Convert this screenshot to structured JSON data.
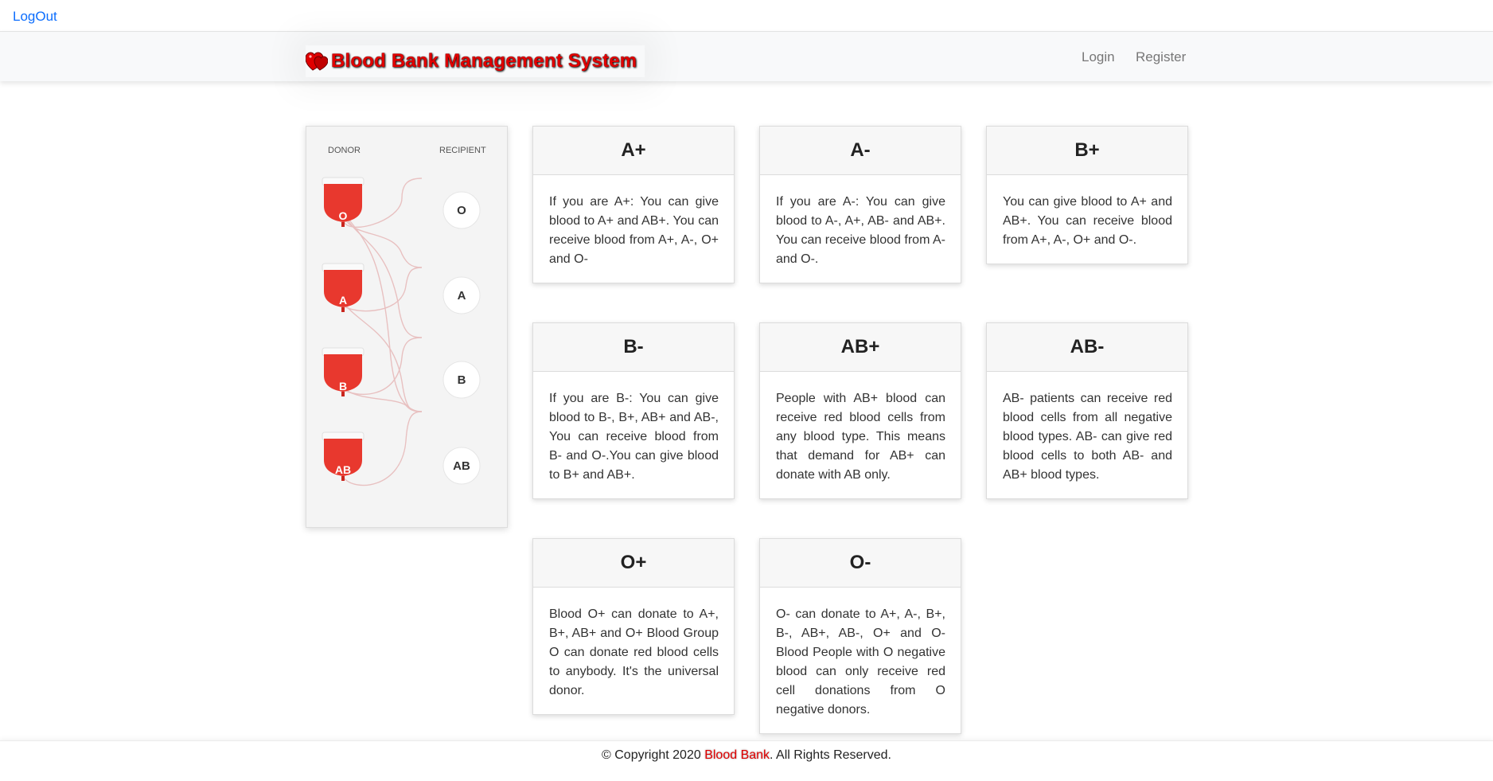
{
  "top_bar": {
    "logout_label": "LogOut"
  },
  "navbar": {
    "brand": "Blood Bank Management System",
    "links": [
      {
        "label": "Login"
      },
      {
        "label": "Register"
      }
    ]
  },
  "compatibility_chart": {
    "donor_label": "DONOR",
    "recipient_label": "RECIPIENT",
    "donors": [
      "O",
      "A",
      "B",
      "AB"
    ],
    "recipients": [
      "O",
      "A",
      "B",
      "AB"
    ]
  },
  "cards": [
    {
      "title": "A+",
      "text": "If you are A+: You can give blood to A+ and AB+. You can receive blood from A+, A-, O+ and O-"
    },
    {
      "title": "A-",
      "text": "If you are A-: You can give blood to A-, A+, AB- and AB+. You can receive blood from A- and O-."
    },
    {
      "title": "B+",
      "text": "You can give blood to A+ and AB+. You can receive blood from A+, A-, O+ and O-."
    },
    {
      "title": "B-",
      "text": "If you are B-: You can give blood to B-, B+, AB+ and AB-, You can receive blood from B- and O-.You can give blood to B+ and AB+."
    },
    {
      "title": "AB+",
      "text": "People with AB+ blood can receive red blood cells from any blood type. This means that demand for AB+ can donate with AB only."
    },
    {
      "title": "AB-",
      "text": "AB- patients can receive red blood cells from all negative blood types. AB- can give red blood cells to both AB- and AB+ blood types."
    },
    {
      "title": "O+",
      "text": "Blood O+ can donate to A+, B+, AB+ and O+ Blood Group O can donate red blood cells to anybody. It's the universal donor."
    },
    {
      "title": "O-",
      "text": "O- can donate to A+, A-, B+, B-, AB+, AB-, O+ and O- Blood People with O negative blood can only receive red cell donations from O negative donors."
    }
  ],
  "footer": {
    "prefix": "© Copyright 2020 ",
    "brand": "Blood Bank",
    "suffix": ". All Rights Reserved."
  },
  "colors": {
    "brand_red": "#e00000",
    "bag_red": "#e8382e",
    "link_blue": "#0d6efd"
  }
}
